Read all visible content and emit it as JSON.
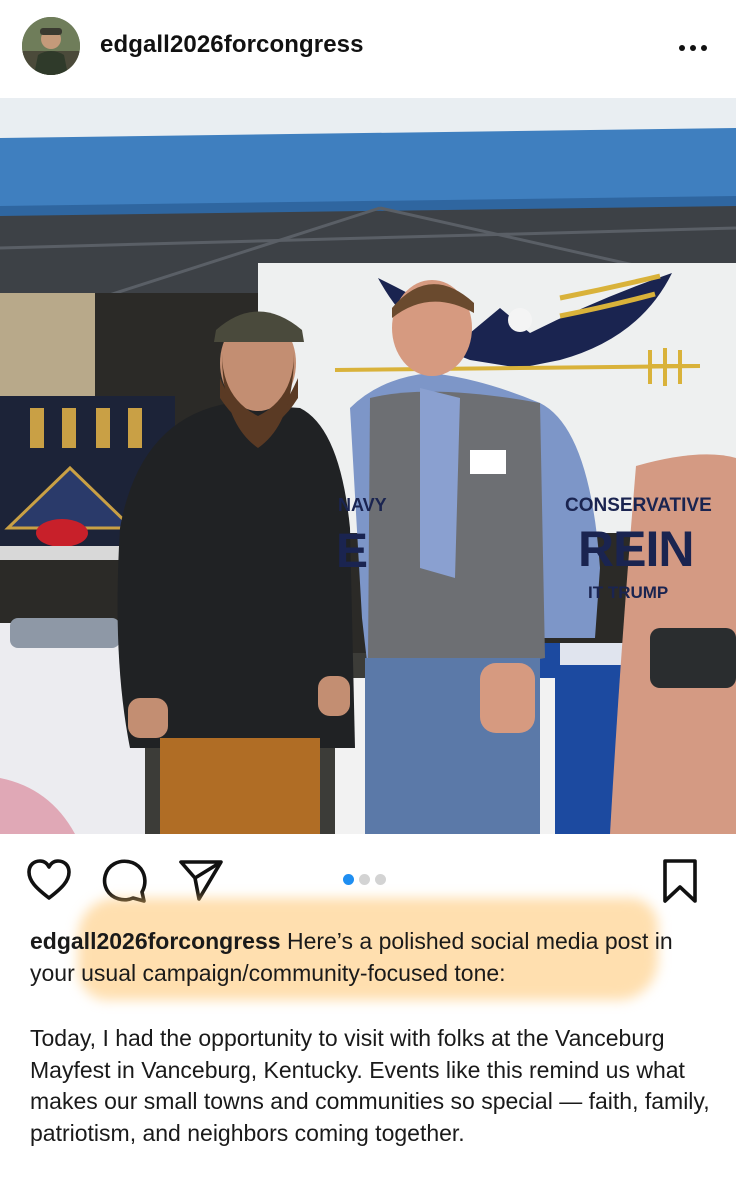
{
  "post": {
    "username": "edgall2026forcongress"
  },
  "header": {
    "avatar_icon": "profile-avatar",
    "more_icon": "more-horizontal-icon"
  },
  "photo": {
    "banner": {
      "navy": "NAVY",
      "conservative": "CONSERVATIVE",
      "name_fragment_left": "E",
      "name_fragment_right": "REIN",
      "tagline_fragment": "IT TRUMP"
    }
  },
  "actions": {
    "like_icon": "heart-icon",
    "comment_icon": "comment-icon",
    "share_icon": "send-icon",
    "save_icon": "bookmark-icon",
    "carousel_total": 3,
    "carousel_active": 1
  },
  "caption": {
    "username": "edgall2026forcongress",
    "intro": "Here’s a polished social media post in your usual campaign/community-focused tone:",
    "body": "Today, I had the opportunity to visit with folks at the Vanceburg Mayfest in Vanceburg, Kentucky. Events like this remind us what makes our small towns and communities so special — faith, family, patriotism, and neighbors coming together."
  },
  "colors": {
    "highlight": "#ffc46e",
    "carousel_active": "#1f8ef1",
    "tent_blue": "#3f7fbf"
  }
}
